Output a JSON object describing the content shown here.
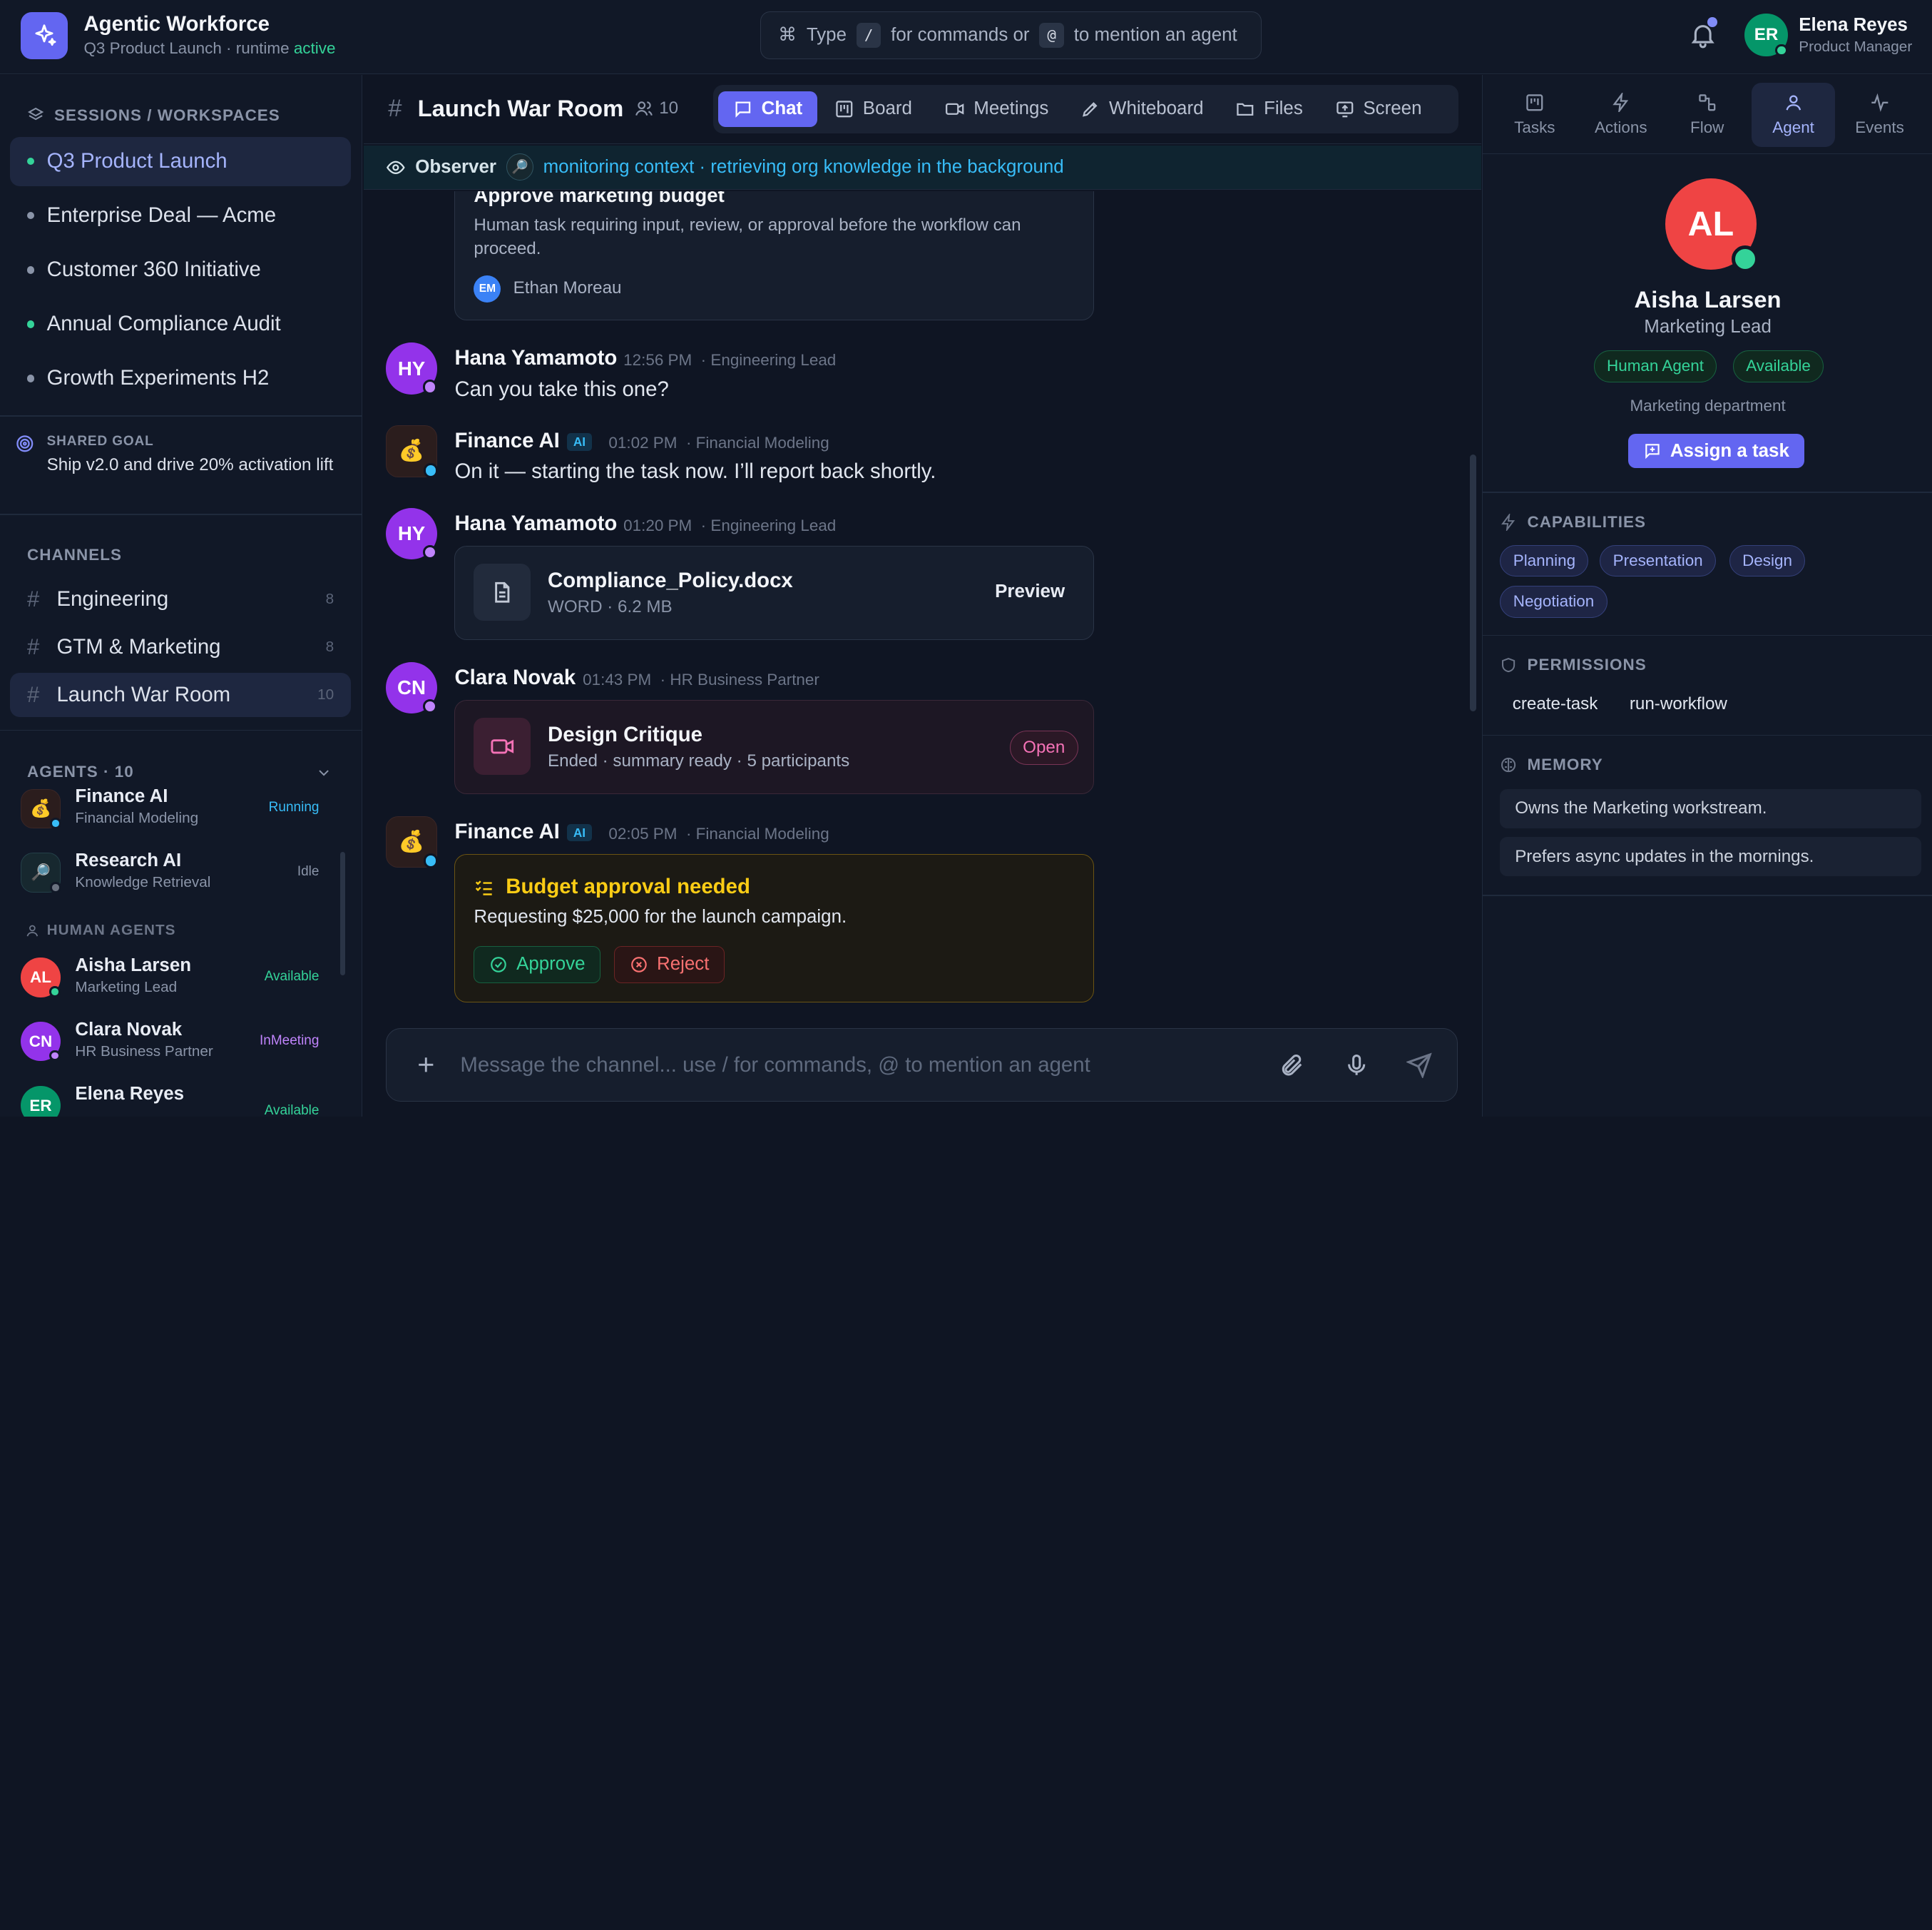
{
  "app": {
    "title": "Agentic Workforce",
    "subtitle_prefix": "Q3 Product Launch · runtime",
    "runtime_status": "active"
  },
  "command_bar": {
    "type_label": "Type",
    "slash_key": "/",
    "middle_text": "for commands or",
    "at_key": "@",
    "end_text": "to mention an agent"
  },
  "current_user": {
    "initials": "ER",
    "name": "Elena Reyes",
    "role": "Product Manager"
  },
  "sidebar": {
    "sessions_label": "SESSIONS / WORKSPACES",
    "workspaces": [
      {
        "label": "Q3 Product Launch",
        "dot": "#34d399"
      },
      {
        "label": "Enterprise Deal — Acme",
        "dot": "#8a94a8"
      },
      {
        "label": "Customer 360 Initiative",
        "dot": "#8a94a8"
      },
      {
        "label": "Annual Compliance Audit",
        "dot": "#34d399"
      },
      {
        "label": "Growth Experiments H2",
        "dot": "#8a94a8"
      }
    ],
    "goal_label": "SHARED GOAL",
    "goal_text": "Ship v2.0 and drive 20% activation lift",
    "channels_label": "CHANNELS",
    "channels": [
      {
        "name": "Engineering",
        "count": "8"
      },
      {
        "name": "GTM & Marketing",
        "count": "8"
      },
      {
        "name": "Launch War Room",
        "count": "10"
      }
    ],
    "agents_label": "AGENTS · 10",
    "ai_agents": [
      {
        "name": "Finance AI",
        "role": "Financial Modeling",
        "status": "Running"
      },
      {
        "name": "Research AI",
        "role": "Knowledge Retrieval",
        "status": "Idle"
      }
    ],
    "human_agents_label": "HUMAN AGENTS",
    "human_agents": [
      {
        "initials": "AL",
        "name": "Aisha Larsen",
        "role": "Marketing Lead",
        "status": "Available"
      },
      {
        "initials": "CN",
        "name": "Clara Novak",
        "role": "HR Business Partner",
        "status": "InMeeting"
      },
      {
        "initials": "ER",
        "name": "Elena Reyes",
        "role": "",
        "status": "Available"
      }
    ]
  },
  "channel": {
    "hash": "#",
    "title": "Launch War Room",
    "members": "10",
    "tabs": [
      "Chat",
      "Board",
      "Meetings",
      "Whiteboard",
      "Files",
      "Screen"
    ],
    "active_tab": "Chat",
    "observer_label": "Observer",
    "observer_text": "monitoring context · retrieving org knowledge in the background"
  },
  "messages": {
    "task_card": {
      "title": "Approve marketing budget",
      "desc": "Human task requiring input, review, or approval before the workflow can proceed.",
      "assignee_initials": "EM",
      "assignee": "Ethan Moreau"
    },
    "m1": {
      "initials": "HY",
      "name": "Hana Yamamoto",
      "time": "12:56 PM",
      "role": "· Engineering Lead",
      "text": "Can you take this one?"
    },
    "m2": {
      "name": "Finance AI",
      "ai": "AI",
      "time": "01:02 PM",
      "role": "· Financial Modeling",
      "text": "On it — starting the task now. I’ll report back shortly."
    },
    "m3": {
      "initials": "HY",
      "name": "Hana Yamamoto",
      "time": "01:20 PM",
      "role": "· Engineering Lead",
      "file_name": "Compliance_Policy.docx",
      "file_meta": "WORD · 6.2 MB",
      "file_action": "Preview"
    },
    "m4": {
      "initials": "CN",
      "name": "Clara Novak",
      "time": "01:43 PM",
      "role": "· HR Business Partner",
      "meeting_title": "Design Critique",
      "meeting_meta": "Ended · summary ready · 5 participants",
      "meeting_action": "Open"
    },
    "m5": {
      "name": "Finance AI",
      "ai": "AI",
      "time": "02:05 PM",
      "role": "· Financial Modeling",
      "approval_title": "Budget approval needed",
      "approval_text": "Requesting $25,000 for the launch campaign.",
      "approve": "Approve",
      "reject": "Reject"
    }
  },
  "composer": {
    "placeholder": "Message the channel... use / for commands, @ to mention an agent"
  },
  "right_panel": {
    "tabs": [
      "Tasks",
      "Actions",
      "Flow",
      "Agent",
      "Events"
    ],
    "active_tab": "Agent",
    "agent": {
      "initials": "AL",
      "name": "Aisha Larsen",
      "role": "Marketing Lead",
      "type_chip": "Human Agent",
      "status_chip": "Available",
      "department": "Marketing department",
      "assign_label": "Assign a task"
    },
    "capabilities_label": "CAPABILITIES",
    "capabilities": [
      "Planning",
      "Presentation",
      "Design",
      "Negotiation"
    ],
    "permissions_label": "PERMISSIONS",
    "permissions": [
      "create-task",
      "run-workflow"
    ],
    "memory_label": "MEMORY",
    "memory": [
      "Owns the Marketing workstream.",
      "Prefers async updates in the mornings."
    ]
  },
  "colors": {
    "accent": "#6366f1",
    "success": "#34d399",
    "observer": "#38bdf8",
    "meeting": "#f472b6",
    "warning": "#facc15",
    "danger": "#f87171"
  }
}
